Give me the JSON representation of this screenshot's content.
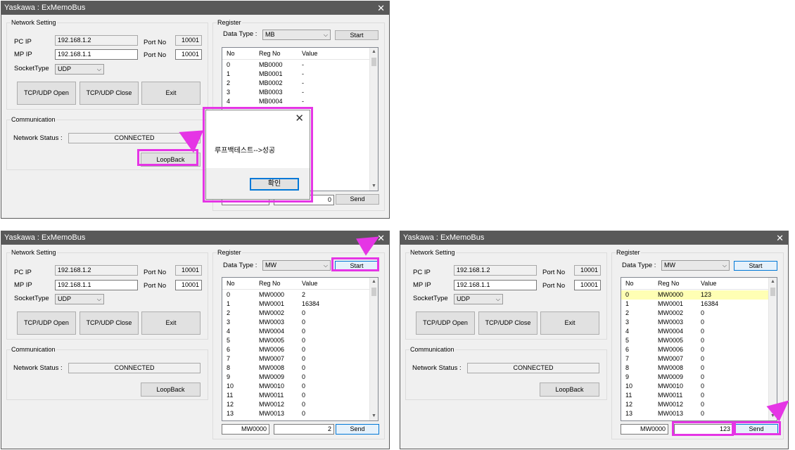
{
  "common": {
    "window_title": "Yaskawa : ExMemoBus",
    "network_group": "Network Setting",
    "pc_ip_label": "PC IP",
    "mp_ip_label": "MP IP",
    "port_label": "Port No",
    "socket_label": "SocketType",
    "socket_value": "UDP",
    "open_label": "TCP/UDP Open",
    "close_label": "TCP/UDP Close",
    "exit_label": "Exit",
    "comm_group": "Communication",
    "status_label": "Network Status :",
    "status_value": "CONNECTED",
    "loopback_label": "LoopBack",
    "register_group": "Register",
    "data_type_label": "Data Type :",
    "start_label": "Start",
    "send_label": "Send",
    "col_no": "No",
    "col_reg": "Reg No",
    "col_value": "Value",
    "close_glyph": "✕"
  },
  "win1": {
    "pc_ip": "192.168.1.2",
    "pc_port": "10001",
    "mp_ip": "192.168.1.1",
    "mp_port": "10001",
    "data_type": "MB",
    "send_reg": "",
    "send_value": "0",
    "rows": [
      {
        "no": "0",
        "reg": "MB0000",
        "value": "-"
      },
      {
        "no": "1",
        "reg": "MB0001",
        "value": "-"
      },
      {
        "no": "2",
        "reg": "MB0002",
        "value": "-"
      },
      {
        "no": "3",
        "reg": "MB0003",
        "value": "-"
      },
      {
        "no": "4",
        "reg": "MB0004",
        "value": "-"
      }
    ],
    "dialog": {
      "message": "루프백테스트-->성공",
      "ok": "확인",
      "close": "✕"
    }
  },
  "win2": {
    "pc_ip": "192.168.1.2",
    "pc_port": "10001",
    "mp_ip": "192.168.1.1",
    "mp_port": "10001",
    "data_type": "MW",
    "send_reg": "MW0000",
    "send_value": "2",
    "rows": [
      {
        "no": "0",
        "reg": "MW0000",
        "value": "2"
      },
      {
        "no": "1",
        "reg": "MW0001",
        "value": "16384"
      },
      {
        "no": "2",
        "reg": "MW0002",
        "value": "0"
      },
      {
        "no": "3",
        "reg": "MW0003",
        "value": "0"
      },
      {
        "no": "4",
        "reg": "MW0004",
        "value": "0"
      },
      {
        "no": "5",
        "reg": "MW0005",
        "value": "0"
      },
      {
        "no": "6",
        "reg": "MW0006",
        "value": "0"
      },
      {
        "no": "7",
        "reg": "MW0007",
        "value": "0"
      },
      {
        "no": "8",
        "reg": "MW0008",
        "value": "0"
      },
      {
        "no": "9",
        "reg": "MW0009",
        "value": "0"
      },
      {
        "no": "10",
        "reg": "MW0010",
        "value": "0"
      },
      {
        "no": "11",
        "reg": "MW0011",
        "value": "0"
      },
      {
        "no": "12",
        "reg": "MW0012",
        "value": "0"
      },
      {
        "no": "13",
        "reg": "MW0013",
        "value": "0"
      }
    ]
  },
  "win3": {
    "pc_ip": "192.168.1.2",
    "pc_port": "10001",
    "mp_ip": "192.168.1.1",
    "mp_port": "10001",
    "data_type": "MW",
    "send_reg": "MW0000",
    "send_value": "123",
    "rows": [
      {
        "no": "0",
        "reg": "MW0000",
        "value": "123"
      },
      {
        "no": "1",
        "reg": "MW0001",
        "value": "16384"
      },
      {
        "no": "2",
        "reg": "MW0002",
        "value": "0"
      },
      {
        "no": "3",
        "reg": "MW0003",
        "value": "0"
      },
      {
        "no": "4",
        "reg": "MW0004",
        "value": "0"
      },
      {
        "no": "5",
        "reg": "MW0005",
        "value": "0"
      },
      {
        "no": "6",
        "reg": "MW0006",
        "value": "0"
      },
      {
        "no": "7",
        "reg": "MW0007",
        "value": "0"
      },
      {
        "no": "8",
        "reg": "MW0008",
        "value": "0"
      },
      {
        "no": "9",
        "reg": "MW0009",
        "value": "0"
      },
      {
        "no": "10",
        "reg": "MW0010",
        "value": "0"
      },
      {
        "no": "11",
        "reg": "MW0011",
        "value": "0"
      },
      {
        "no": "12",
        "reg": "MW0012",
        "value": "0"
      },
      {
        "no": "13",
        "reg": "MW0013",
        "value": "0"
      }
    ]
  },
  "colors": {
    "highlight": "#e535e5",
    "titlebar": "#595959",
    "selected_row": "#ffffb4"
  }
}
